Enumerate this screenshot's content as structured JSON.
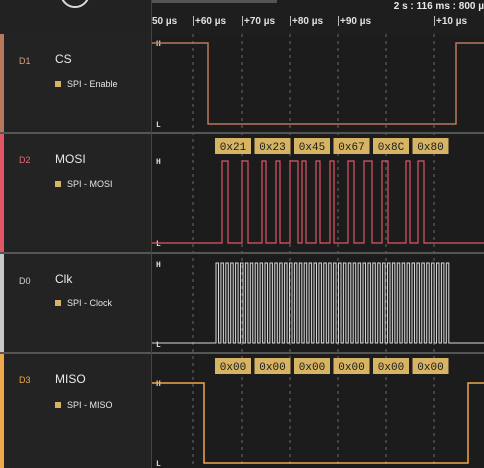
{
  "timeline": {
    "time_info": "2 s : 116 ms : 800 µ",
    "ticks": [
      "50 µs",
      "+60 µs",
      "+70 µs",
      "+80 µs",
      "+90 µs",
      "+10 µs"
    ]
  },
  "channels": [
    {
      "id": "D1",
      "name": "CS",
      "tag": "SPI - Enable",
      "color": "#b8785c",
      "id_color": "#d7a07c"
    },
    {
      "id": "D2",
      "name": "MOSI",
      "tag": "SPI - MOSI",
      "color": "#e15565",
      "id_color": "#e36c78"
    },
    {
      "id": "D0",
      "name": "Clk",
      "tag": "SPI - Clock",
      "color": "#c8c8c8",
      "id_color": "#d0d0d0"
    },
    {
      "id": "D3",
      "name": "MISO",
      "tag": "SPI - MISO",
      "color": "#f0a84c",
      "id_color": "#f0a84c"
    }
  ],
  "levels": {
    "high": "H",
    "low": "L"
  },
  "mosi_bytes": [
    "0x21",
    "0x23",
    "0x45",
    "0x67",
    "0x8C",
    "0x80"
  ],
  "miso_bytes": [
    "0x00",
    "0x00",
    "0x00",
    "0x00",
    "0x00",
    "0x00"
  ],
  "colors": {
    "byte_badge": "#d6b463",
    "byte_text": "#1a1a1a",
    "grid": "#6a6a6a"
  }
}
